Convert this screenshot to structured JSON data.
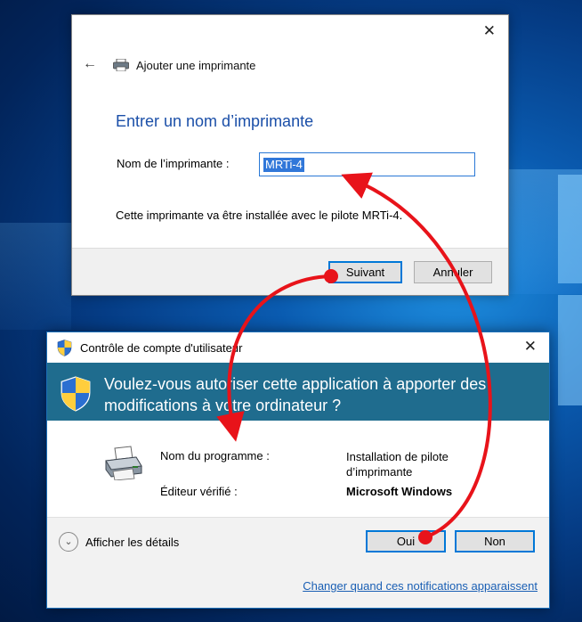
{
  "dialog1": {
    "close_icon": "close-icon",
    "back_icon": "back-arrow-icon",
    "title_icon": "printer-icon",
    "title": "Ajouter une imprimante",
    "heading": "Entrer un nom d’imprimante",
    "name_label": "Nom de l’imprimante :",
    "name_value": "MRTi-4",
    "info": "Cette imprimante va être installée avec le pilote MRTi-4.",
    "next_button": "Suivant",
    "cancel_button": "Annuler",
    "accent": "#0078d7"
  },
  "dialog2": {
    "title": "Contrôle de compte d'utilisateur",
    "title_icon": "uac-shield-icon",
    "close_icon": "close-icon",
    "question": "Voulez-vous autoriser cette application à apporter des modifications à votre ordinateur ?",
    "banner_color": "#1f6c8e",
    "program_label": "Nom du programme :",
    "program_value": "Installation de pilote d’imprimante",
    "publisher_label": "Éditeur vérifié :",
    "publisher_value": "Microsoft Windows",
    "details_label": "Afficher les détails",
    "yes_button": "Oui",
    "no_button": "Non",
    "link": "Changer quand ces notifications apparaissent"
  },
  "annotations": {
    "arrow_color": "#e8131a"
  }
}
